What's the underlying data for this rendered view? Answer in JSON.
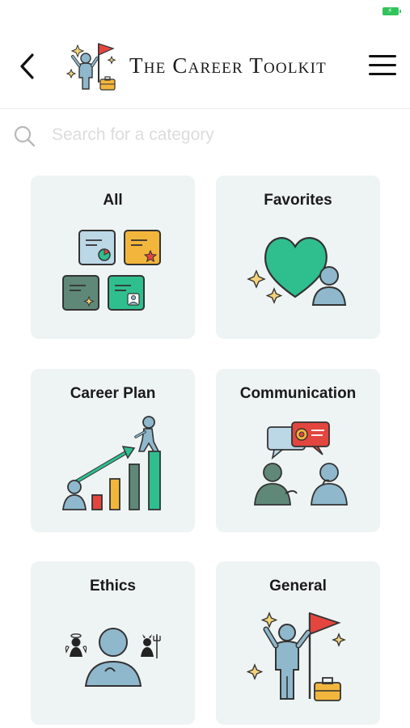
{
  "header": {
    "title": "The Career Toolkit"
  },
  "search": {
    "placeholder": "Search for a category"
  },
  "categories": [
    {
      "label": "All"
    },
    {
      "label": "Favorites"
    },
    {
      "label": "Career Plan"
    },
    {
      "label": "Communication"
    },
    {
      "label": "Ethics"
    },
    {
      "label": "General"
    }
  ],
  "colors": {
    "card_bg": "#eef4f3",
    "accent_green": "#2fbf8f",
    "figure_blue": "#8fb8cc",
    "flag_red": "#e2463f",
    "star_yellow": "#f3b63c",
    "battery_green": "#33c35b"
  }
}
